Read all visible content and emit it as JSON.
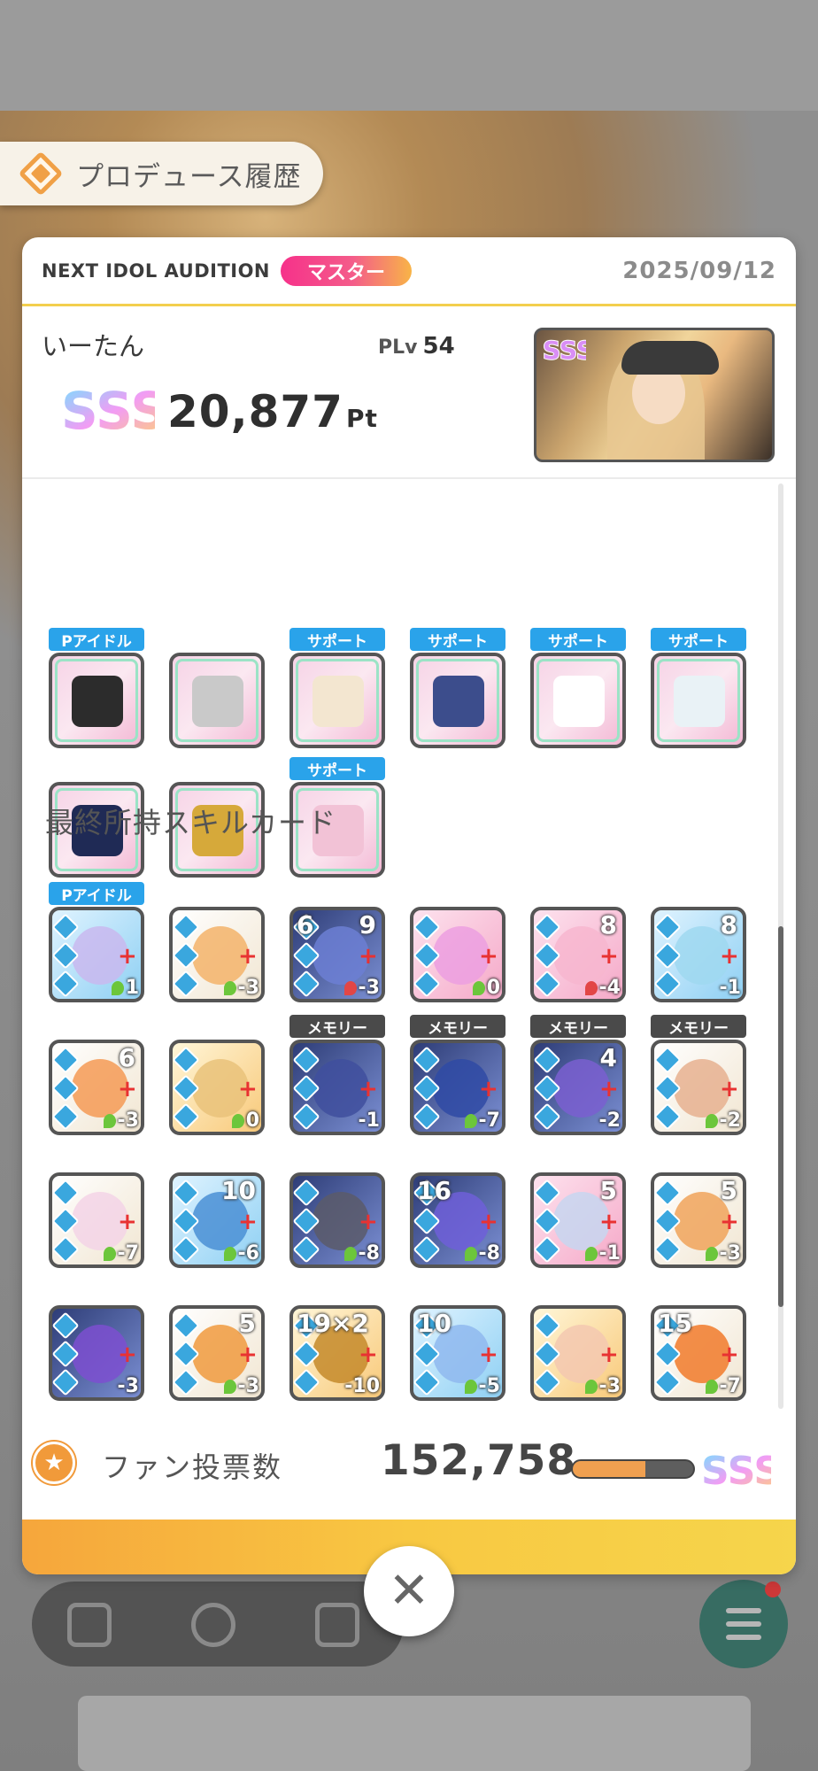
{
  "header": {
    "title": "プロデュース履歴",
    "icon": "history-diamond-icon"
  },
  "panel": {
    "audition": "NEXT IDOL AUDITION",
    "rank": "マスター",
    "date": "2025/09/12"
  },
  "player": {
    "name": "いーたん",
    "plv_label": "PLv",
    "plv_value": "54",
    "grade": "SSS",
    "score": "20,877",
    "score_unit": "Pt"
  },
  "items": [
    {
      "tag": "Pアイドル",
      "icon": "beret-hat-icon"
    },
    {
      "tag": "",
      "icon": "nia-badge-pouch-icon"
    },
    {
      "tag": "サポート",
      "icon": "clipboard-icon"
    },
    {
      "tag": "サポート",
      "icon": "hedgehog-plush-icon"
    },
    {
      "tag": "サポート",
      "icon": "bouquet-card-icon"
    },
    {
      "tag": "サポート",
      "icon": "bento-box-icon"
    },
    {
      "tag": "",
      "icon": "nia-card-keychain-icon"
    },
    {
      "tag": "",
      "icon": "idol-ring-icon"
    },
    {
      "tag": "サポート",
      "icon": "donut-cup-icon"
    }
  ],
  "skill_section_title": "最終所持スキルカード",
  "cards": [
    {
      "tag": "Pアイドル",
      "lvl": "",
      "cost": "1",
      "costcolor": "green"
    },
    {
      "tag": "",
      "lvl": "",
      "cost": "-3",
      "costcolor": "green"
    },
    {
      "tag": "",
      "lvl": "9",
      "lvl_left": "6",
      "cost": "-3",
      "costcolor": "red"
    },
    {
      "tag": "",
      "lvl": "",
      "cost": "0",
      "costcolor": "green"
    },
    {
      "tag": "",
      "lvl": "8",
      "cost": "-4",
      "costcolor": "red"
    },
    {
      "tag": "",
      "lvl": "8",
      "cost": "-1",
      "costcolor": "none"
    },
    {
      "tag": "",
      "lvl": "6",
      "cost": "-3",
      "costcolor": "green"
    },
    {
      "tag": "",
      "lvl": "",
      "cost": "0",
      "costcolor": "green"
    },
    {
      "tag": "メモリー",
      "lvl": "",
      "cost": "-1",
      "costcolor": "none"
    },
    {
      "tag": "メモリー",
      "lvl": "",
      "cost": "-7",
      "costcolor": "green"
    },
    {
      "tag": "メモリー",
      "lvl": "4",
      "cost": "-2",
      "costcolor": "none"
    },
    {
      "tag": "メモリー",
      "lvl": "",
      "cost": "-2",
      "costcolor": "green"
    },
    {
      "tag": "",
      "lvl": "",
      "cost": "-7",
      "costcolor": "green"
    },
    {
      "tag": "",
      "lvl": "10",
      "cost": "-6",
      "costcolor": "green"
    },
    {
      "tag": "",
      "lvl": "",
      "cost": "-8",
      "costcolor": "green"
    },
    {
      "tag": "",
      "lvl": "",
      "lvl_left": "16",
      "cost": "-8",
      "costcolor": "green"
    },
    {
      "tag": "",
      "lvl": "5",
      "cost": "-1",
      "costcolor": "green"
    },
    {
      "tag": "",
      "lvl": "5",
      "cost": "-3",
      "costcolor": "green"
    },
    {
      "tag": "",
      "lvl": "",
      "cost": "-3",
      "costcolor": "none"
    },
    {
      "tag": "",
      "lvl": "5",
      "cost": "-3",
      "costcolor": "green"
    },
    {
      "tag": "",
      "lvl": "",
      "lvl_left": "19×2",
      "cost": "-10",
      "costcolor": "none"
    },
    {
      "tag": "",
      "lvl": "",
      "lvl_left": "10",
      "cost": "-5",
      "costcolor": "green"
    },
    {
      "tag": "",
      "lvl": "",
      "cost": "-3",
      "costcolor": "green"
    },
    {
      "tag": "",
      "lvl": "",
      "lvl_left": "15",
      "cost": "-7",
      "costcolor": "green"
    }
  ],
  "fan": {
    "label": "ファン投票数",
    "value": "152,758",
    "progress": 0.6,
    "grade": "SSS"
  },
  "colors": {
    "accent_pink": "#f6318a",
    "accent_orange": "#f6a63c",
    "tag_blue": "#2aa3ea",
    "tag_memory": "#4a4a4a"
  }
}
